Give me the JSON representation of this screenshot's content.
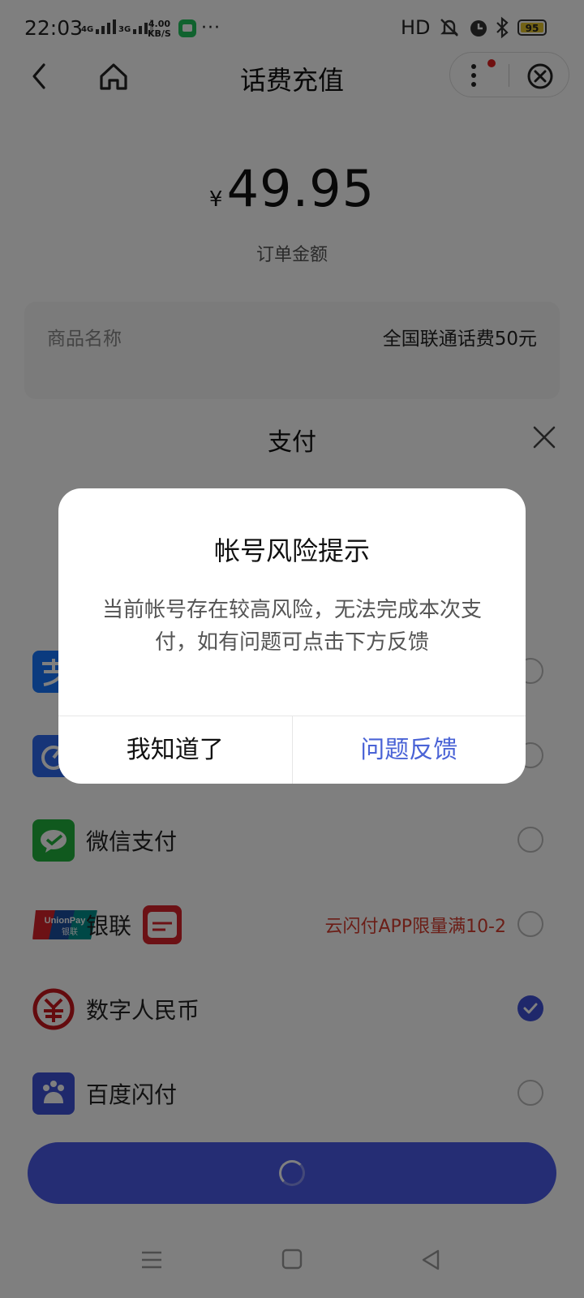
{
  "status_bar": {
    "time": "22:03",
    "net1": "4G",
    "net2": "3G",
    "speed_value": "4.00",
    "speed_unit": "KB/S",
    "more": "···",
    "hd": "HD",
    "battery": "95"
  },
  "nav": {
    "title": "话费充值"
  },
  "order": {
    "currency": "¥",
    "amount": "49.95",
    "amount_label": "订单金额",
    "product_key": "商品名称",
    "product_value": "全国联通话费50元"
  },
  "sheet": {
    "title": "支付",
    "methods": [
      {
        "name": "微信支付",
        "icon": "wechat-pay-icon",
        "selected": false
      },
      {
        "name": "银联",
        "icon": "unionpay-icon",
        "badge_icon": "yunshanfu-icon",
        "promo": "云闪付APP限量满10-2",
        "selected": false
      },
      {
        "name": "数字人民币",
        "icon": "digital-rmb-icon",
        "selected": true
      },
      {
        "name": "百度闪付",
        "icon": "baidu-pay-icon",
        "selected": false
      }
    ]
  },
  "dialog": {
    "title": "帐号风险提示",
    "body": "当前帐号存在较高风险，无法完成本次支付，如有问题可点击下方反馈",
    "ok_label": "我知道了",
    "feedback_label": "问题反馈"
  },
  "colors": {
    "accent": "#4a5ae8",
    "promo": "#d63d2e",
    "dialog_link": "#4a63d6"
  }
}
